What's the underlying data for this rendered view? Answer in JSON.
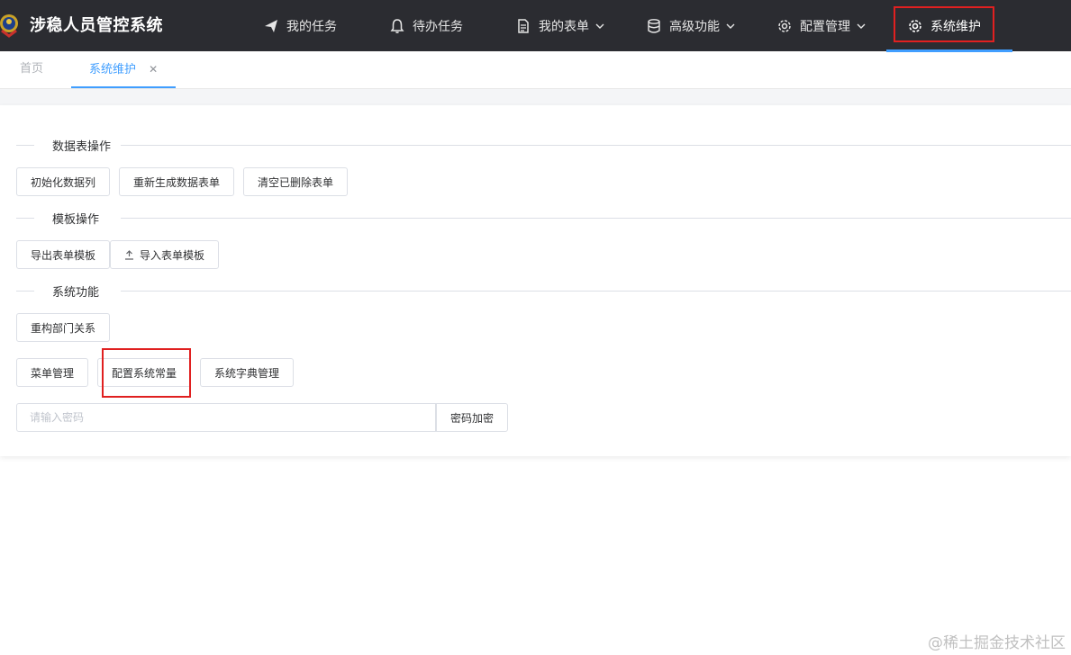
{
  "header": {
    "app_title": "涉稳人员管控系统",
    "nav": [
      {
        "label": "我的任务",
        "icon": "send-icon"
      },
      {
        "label": "待办任务",
        "icon": "bell-icon"
      },
      {
        "label": "我的表单",
        "icon": "document-icon",
        "has_dropdown": true
      },
      {
        "label": "高级功能",
        "icon": "database-icon",
        "has_dropdown": true
      },
      {
        "label": "配置管理",
        "icon": "gear-icon",
        "has_dropdown": true
      },
      {
        "label": "系统维护",
        "icon": "gear-icon",
        "active": true
      }
    ]
  },
  "tabs": [
    {
      "label": "首页"
    },
    {
      "label": "系统维护",
      "active": true,
      "closable": true
    }
  ],
  "sections": {
    "data_table": {
      "title": "数据表操作",
      "buttons": [
        "初始化数据列",
        "重新生成数据表单",
        "清空已删除表单"
      ]
    },
    "template": {
      "title": "模板操作",
      "buttons": [
        "导出表单模板",
        "导入表单模板"
      ]
    },
    "system": {
      "title": "系统功能",
      "buttons": [
        "重构部门关系",
        "菜单管理",
        "配置系统常量",
        "系统字典管理"
      ]
    }
  },
  "password": {
    "placeholder": "请输入密码",
    "value": "",
    "encrypt_button": "密码加密"
  },
  "watermark": "@稀土掘金技术社区",
  "colors": {
    "header_bg": "#2b2c31",
    "accent": "#409eff",
    "highlight_border": "#e02020"
  }
}
